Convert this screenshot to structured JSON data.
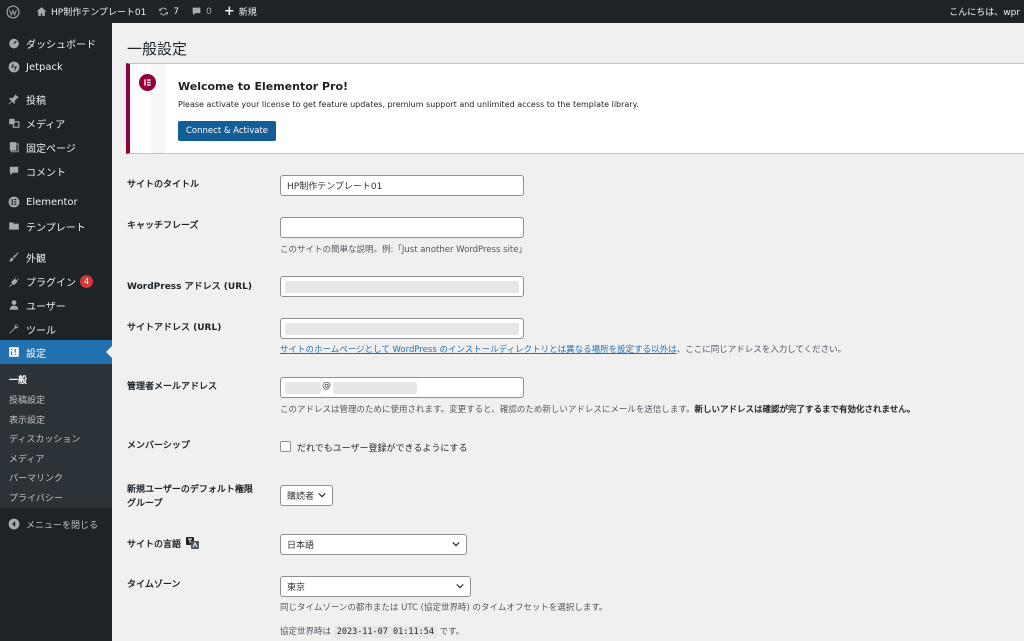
{
  "admin_bar": {
    "site_name": "HP制作テンプレート01",
    "updates_count": "7",
    "comments_count": "0",
    "new_label": "新規",
    "greeting": "こんにちは、wpr"
  },
  "sidebar": {
    "items": [
      {
        "label": "ダッシュボード",
        "icon": "dashboard-icon"
      },
      {
        "label": "Jetpack",
        "icon": "jetpack-icon"
      },
      {
        "label": "投稿",
        "icon": "pin-icon"
      },
      {
        "label": "メディア",
        "icon": "media-icon"
      },
      {
        "label": "固定ページ",
        "icon": "page-icon"
      },
      {
        "label": "コメント",
        "icon": "comment-icon"
      },
      {
        "label": "Elementor",
        "icon": "elementor-icon"
      },
      {
        "label": "テンプレート",
        "icon": "folder-icon"
      },
      {
        "label": "外観",
        "icon": "brush-icon"
      },
      {
        "label": "プラグイン",
        "icon": "plugin-icon",
        "badge": "4"
      },
      {
        "label": "ユーザー",
        "icon": "user-icon"
      },
      {
        "label": "ツール",
        "icon": "wrench-icon"
      },
      {
        "label": "設定",
        "icon": "settings-icon"
      }
    ],
    "submenu": [
      "一般",
      "投稿設定",
      "表示設定",
      "ディスカッション",
      "メディア",
      "パーマリンク",
      "プライバシー"
    ],
    "collapse_label": "メニューを閉じる"
  },
  "page_title": "一般設定",
  "notice": {
    "title": "Welcome to Elementor Pro!",
    "text": "Please activate your license to get feature updates, premium support and unlimited access to the template library.",
    "button": "Connect & Activate"
  },
  "form": {
    "site_title_label": "サイトのタイトル",
    "site_title_value": "HP制作テンプレート01",
    "tagline_label": "キャッチフレーズ",
    "tagline_value": "",
    "tagline_desc": "このサイトの簡単な説明。例:「Just another WordPress site」",
    "wp_url_label": "WordPress アドレス (URL)",
    "site_url_label": "サイトアドレス (URL)",
    "site_url_desc_link": "サイトのホームページとして WordPress のインストールディレクトリとは異なる場所を設定する以外は",
    "site_url_desc_rest": "、ここに同じアドレスを入力してください。",
    "admin_email_label": "管理者メールアドレス",
    "admin_email_at": "@",
    "admin_email_desc": "このアドレスは管理のために使用されます。変更すると、確認のため新しいアドレスにメールを送信します。",
    "admin_email_desc_bold": "新しいアドレスは確認が完了するまで有効化されません。",
    "membership_label": "メンバーシップ",
    "membership_checkbox": "だれでもユーザー登録ができるようにする",
    "default_role_label_1": "新規ユーザーのデフォルト権限",
    "default_role_label_2": "グループ",
    "default_role_value": "購読者",
    "language_label": "サイトの言語",
    "language_value": "日本語",
    "timezone_label": "タイムゾーン",
    "timezone_value": "東京",
    "timezone_desc": "同じタイムゾーンの都市または UTC (協定世界時) のタイムオフセットを選択します。",
    "utc_prefix": "協定世界時は",
    "utc_time": "2023-11-07 01:11:54",
    "utc_suffix": "です。"
  }
}
